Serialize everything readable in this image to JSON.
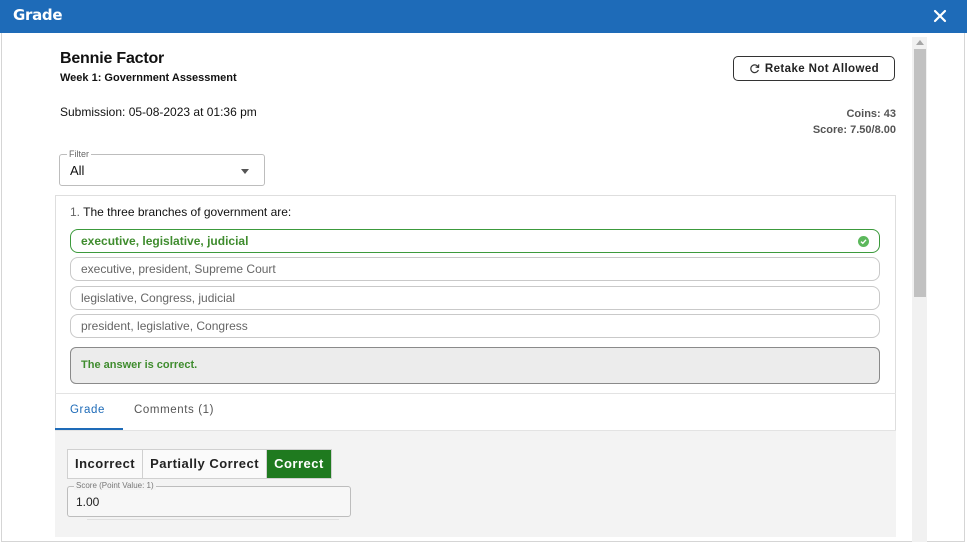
{
  "dialog": {
    "title": "Grade",
    "close_icon": "close-icon"
  },
  "student": {
    "name": "Bennie Factor",
    "assignment": "Week 1: Government Assessment",
    "submission": "Submission: 05-08-2023 at 01:36 pm"
  },
  "header": {
    "retake_label": "Retake Not Allowed",
    "retake_icon": "refresh-icon",
    "coins": "Coins: 43",
    "score": "Score: 7.50/8.00"
  },
  "filter": {
    "legend": "Filter",
    "value": "All"
  },
  "question": {
    "number": "1.",
    "text": "The three branches of government are:",
    "options": [
      {
        "label": "executive, legislative, judicial",
        "correct": true
      },
      {
        "label": "executive, president, Supreme Court",
        "correct": false
      },
      {
        "label": "legislative, Congress, judicial",
        "correct": false
      },
      {
        "label": "president, legislative, Congress",
        "correct": false
      }
    ],
    "feedback": "The answer is correct."
  },
  "tabs": [
    {
      "label": "Grade",
      "active": true
    },
    {
      "label": "Comments (1)",
      "active": false
    }
  ],
  "grading": {
    "buttons": [
      {
        "label": "Incorrect",
        "selected": false
      },
      {
        "label": "Partially Correct",
        "selected": false
      },
      {
        "label": "Correct",
        "selected": true
      }
    ],
    "score_legend": "Score (Point Value: 1)",
    "score_value": "1.00"
  },
  "colors": {
    "primary": "#1e6bb8",
    "correct_green": "#3f8c2e",
    "selected_button": "#1f7a1f"
  }
}
